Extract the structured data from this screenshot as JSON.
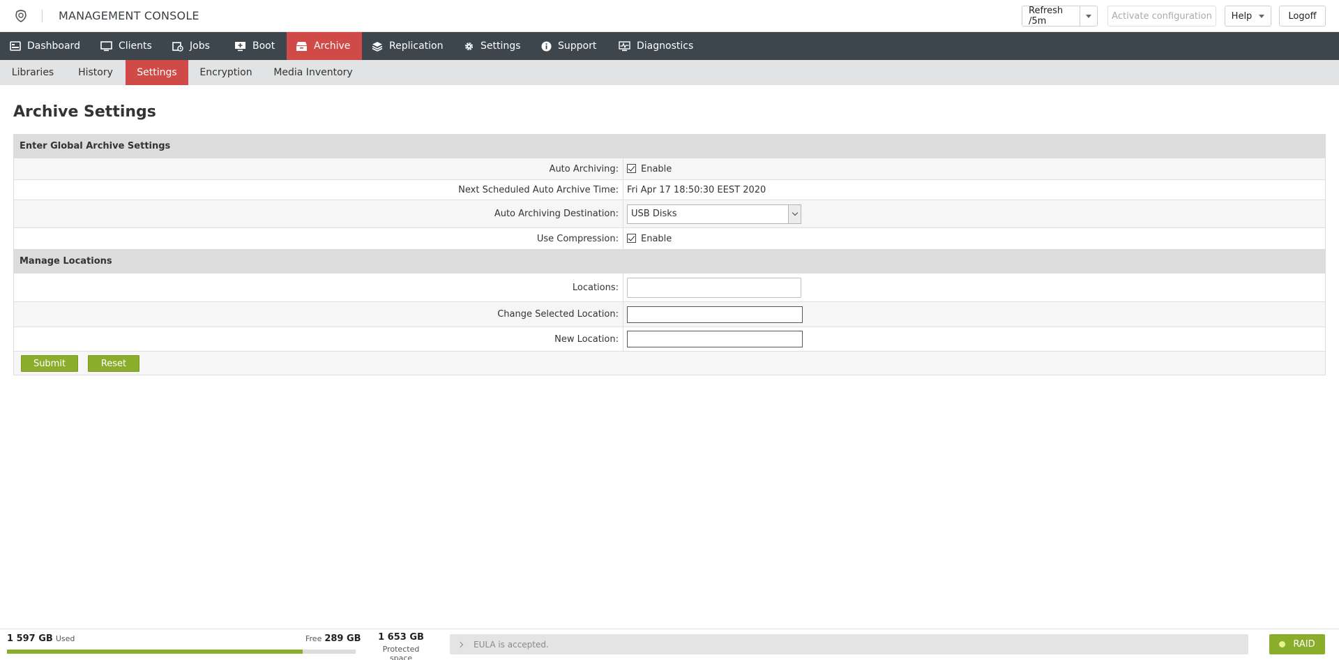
{
  "header": {
    "title": "MANAGEMENT CONSOLE",
    "refresh_label": "Refresh /5m",
    "activate_label": "Activate configuration",
    "help_label": "Help",
    "logoff_label": "Logoff"
  },
  "main_nav": [
    {
      "label": "Dashboard",
      "icon": "dashboard-icon"
    },
    {
      "label": "Clients",
      "icon": "monitor-icon"
    },
    {
      "label": "Jobs",
      "icon": "jobs-icon"
    },
    {
      "label": "Boot",
      "icon": "boot-icon"
    },
    {
      "label": "Archive",
      "icon": "archive-icon",
      "active": true
    },
    {
      "label": "Replication",
      "icon": "layers-icon"
    },
    {
      "label": "Settings",
      "icon": "gear-icon"
    },
    {
      "label": "Support",
      "icon": "info-icon"
    },
    {
      "label": "Diagnostics",
      "icon": "diagnostics-icon"
    }
  ],
  "sub_nav": [
    {
      "label": "Libraries"
    },
    {
      "label": "History"
    },
    {
      "label": "Settings",
      "active": true
    },
    {
      "label": "Encryption"
    },
    {
      "label": "Media Inventory"
    }
  ],
  "page": {
    "title": "Archive Settings",
    "section_global": "Enter Global Archive Settings",
    "auto_archiving_label": "Auto Archiving:",
    "auto_archiving_value": "Enable",
    "next_time_label": "Next Scheduled Auto Archive Time:",
    "next_time_value": "Fri Apr 17 18:50:30 EEST 2020",
    "destination_label": "Auto Archiving Destination:",
    "destination_value": "USB Disks",
    "compression_label": "Use Compression:",
    "compression_value": "Enable",
    "section_locations": "Manage Locations",
    "locations_label": "Locations:",
    "change_location_label": "Change Selected Location:",
    "change_location_value": "",
    "new_location_label": "New Location:",
    "new_location_value": "",
    "submit_label": "Submit",
    "reset_label": "Reset"
  },
  "footer": {
    "used_value": "1 597 GB",
    "used_label": "Used",
    "free_label": "Free",
    "free_value": "289 GB",
    "used_fraction": 0.847,
    "protected_value": "1 653 GB",
    "protected_label": "Protected space",
    "eula_text": "EULA is accepted.",
    "raid_label": "RAID"
  },
  "colors": {
    "nav_bg": "#3d464d",
    "active_red": "#d04a48",
    "accent_green": "#8aad2c"
  }
}
